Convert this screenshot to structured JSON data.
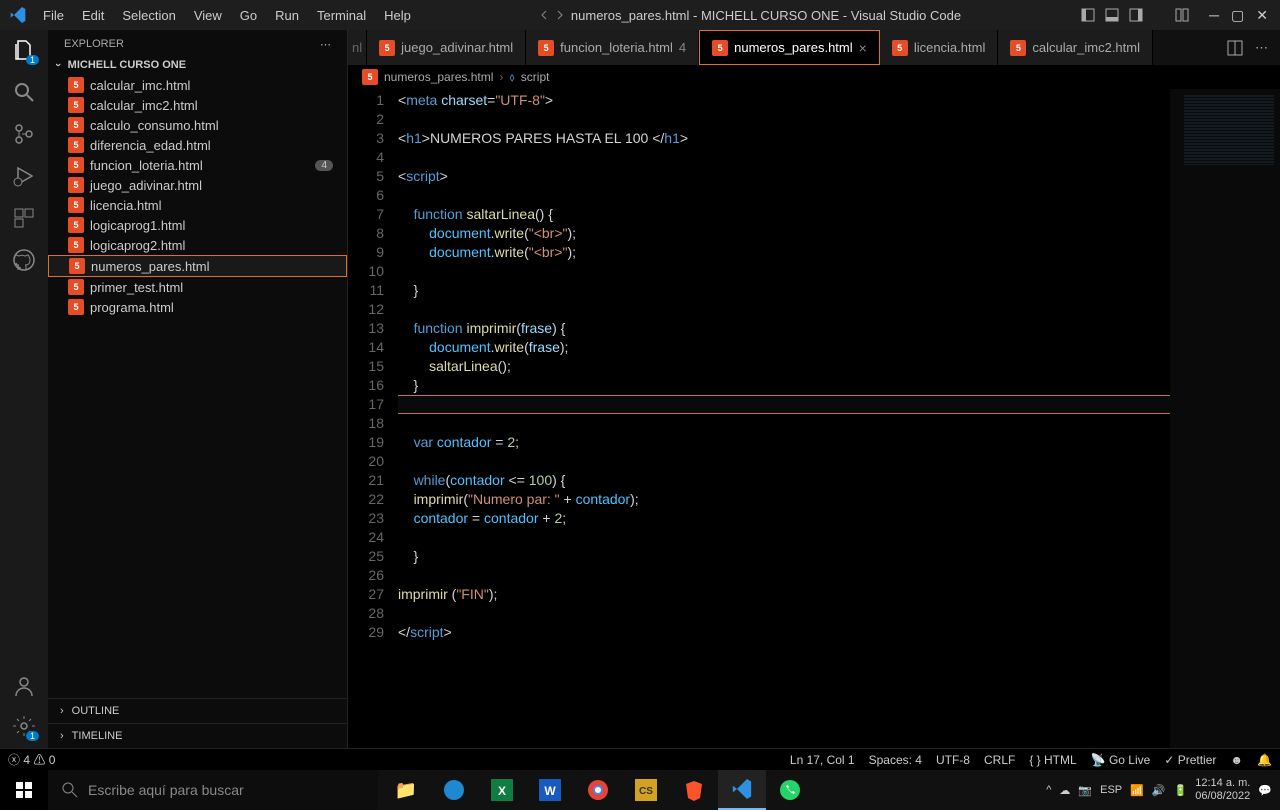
{
  "window": {
    "title": "numeros_pares.html - MICHELL CURSO ONE - Visual Studio Code"
  },
  "menu": [
    "File",
    "Edit",
    "Selection",
    "View",
    "Go",
    "Run",
    "Terminal",
    "Help"
  ],
  "explorer": {
    "title": "EXPLORER",
    "section": "MICHELL CURSO ONE",
    "files": [
      {
        "name": "calcular_imc.html"
      },
      {
        "name": "calcular_imc2.html"
      },
      {
        "name": "calculo_consumo.html"
      },
      {
        "name": "diferencia_edad.html"
      },
      {
        "name": "funcion_loteria.html",
        "badge": "4"
      },
      {
        "name": "juego_adivinar.html"
      },
      {
        "name": "licencia.html"
      },
      {
        "name": "logicaprog1.html"
      },
      {
        "name": "logicaprog2.html"
      },
      {
        "name": "numeros_pares.html",
        "active": true
      },
      {
        "name": "primer_test.html"
      },
      {
        "name": "programa.html"
      }
    ],
    "outline": "OUTLINE",
    "timeline": "TIMELINE"
  },
  "tabs": {
    "items": [
      {
        "label": "juego_adivinar.html"
      },
      {
        "label": "funcion_loteria.html",
        "count": "4"
      },
      {
        "label": "numeros_pares.html",
        "active": true,
        "close": true
      },
      {
        "label": "licencia.html"
      },
      {
        "label": "calcular_imc2.html"
      }
    ],
    "hidden_prefix": "nl"
  },
  "breadcrumb": {
    "file": "numeros_pares.html",
    "symbol": "script"
  },
  "code": {
    "lines": [
      {
        "n": 1,
        "html": "<span class='tk-punc'>&lt;</span><span class='tk-tag'>meta</span> <span class='tk-attr'>charset</span>=<span class='tk-str'>\"UTF-8\"</span><span class='tk-punc'>&gt;</span>"
      },
      {
        "n": 2,
        "html": ""
      },
      {
        "n": 3,
        "html": "<span class='tk-punc'>&lt;</span><span class='tk-tag'>h1</span><span class='tk-punc'>&gt;</span><span class='tk-txt'>NUMEROS PARES HASTA EL 100 </span><span class='tk-punc'>&lt;/</span><span class='tk-tag'>h1</span><span class='tk-punc'>&gt;</span>"
      },
      {
        "n": 4,
        "html": ""
      },
      {
        "n": 5,
        "html": "<span class='tk-punc'>&lt;</span><span class='tk-tag'>script</span><span class='tk-punc'>&gt;</span>"
      },
      {
        "n": 6,
        "html": ""
      },
      {
        "n": 7,
        "html": "    <span class='tk-kw'>function</span> <span class='tk-fn'>saltarLinea</span>() {"
      },
      {
        "n": 8,
        "html": "        <span class='tk-var'>document</span>.<span class='tk-fn'>write</span>(<span class='tk-str'>\"&lt;br&gt;\"</span>);"
      },
      {
        "n": 9,
        "html": "        <span class='tk-var'>document</span>.<span class='tk-fn'>write</span>(<span class='tk-str'>\"&lt;br&gt;\"</span>);"
      },
      {
        "n": 10,
        "html": ""
      },
      {
        "n": 11,
        "html": "    }"
      },
      {
        "n": 12,
        "html": ""
      },
      {
        "n": 13,
        "html": "    <span class='tk-kw'>function</span> <span class='tk-fn'>imprimir</span>(<span class='tk-param'>frase</span>) {"
      },
      {
        "n": 14,
        "html": "        <span class='tk-var'>document</span>.<span class='tk-fn'>write</span>(<span class='tk-param'>frase</span>);"
      },
      {
        "n": 15,
        "html": "        <span class='tk-fn'>saltarLinea</span>();"
      },
      {
        "n": 16,
        "html": "    }"
      },
      {
        "n": 17,
        "html": "",
        "current": true
      },
      {
        "n": 18,
        "html": ""
      },
      {
        "n": 19,
        "html": "    <span class='tk-kw'>var</span> <span class='tk-var'>contador</span> = <span class='tk-num'>2</span>;"
      },
      {
        "n": 20,
        "html": ""
      },
      {
        "n": 21,
        "html": "    <span class='tk-kw'>while</span>(<span class='tk-var'>contador</span> &lt;= <span class='tk-num'>100</span>) {"
      },
      {
        "n": 22,
        "html": "    <span class='tk-fn'>imprimir</span>(<span class='tk-str'>\"Numero par: \"</span> + <span class='tk-var'>contador</span>);"
      },
      {
        "n": 23,
        "html": "    <span class='tk-var'>contador</span> = <span class='tk-var'>contador</span> + <span class='tk-num'>2</span>;"
      },
      {
        "n": 24,
        "html": ""
      },
      {
        "n": 25,
        "html": "    }"
      },
      {
        "n": 26,
        "html": ""
      },
      {
        "n": 27,
        "html": "<span class='tk-fn'>imprimir</span> (<span class='tk-str'>\"FIN\"</span>);"
      },
      {
        "n": 28,
        "html": ""
      },
      {
        "n": 29,
        "html": "<span class='tk-punc'>&lt;/</span><span class='tk-tag'>script</span><span class='tk-punc'>&gt;</span>"
      }
    ]
  },
  "status": {
    "errors": "4",
    "warnings": "0",
    "pos": "Ln 17, Col 1",
    "spaces": "Spaces: 4",
    "enc": "UTF-8",
    "eol": "CRLF",
    "lang": "HTML",
    "golive": "Go Live",
    "prettier": "Prettier"
  },
  "taskbar": {
    "search": "Escribe aquí para buscar",
    "clock": {
      "time": "12:14 a. m.",
      "date": "06/08/2022"
    }
  }
}
